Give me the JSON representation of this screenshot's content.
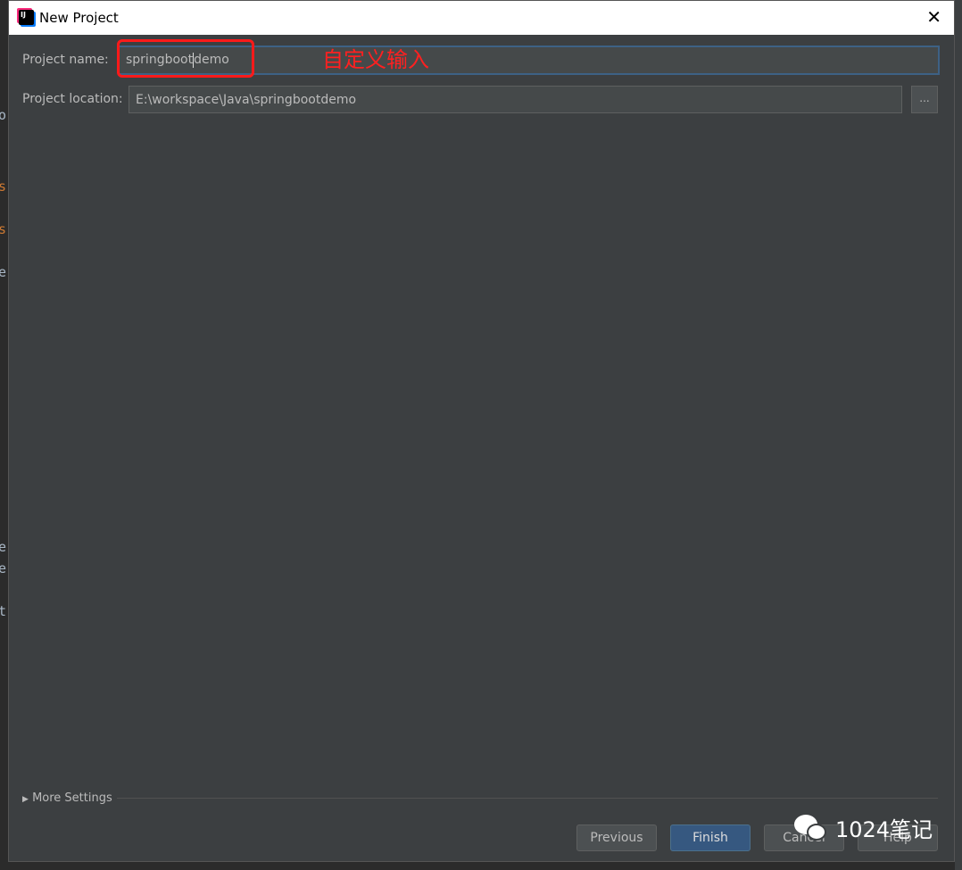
{
  "dialog": {
    "title": "New Project",
    "project_name_label": "Project name:",
    "project_name_value_before_caret": "springboot",
    "project_name_value_after_caret": "demo",
    "project_location_label": "Project location:",
    "project_location_value": "E:\\workspace\\Java\\springbootdemo",
    "browse_label": "...",
    "more_settings_label": "More Settings",
    "buttons": {
      "previous": "Previous",
      "finish": "Finish",
      "cancel": "Cancel",
      "help": "Help"
    }
  },
  "annotation": {
    "text": "自定义输入",
    "color": "#ff2020"
  },
  "watermark": {
    "text": "1024笔记"
  },
  "colors": {
    "dialog_bg": "#3c3f41",
    "primary_button": "#365880",
    "focus_border": "#3d6185"
  }
}
